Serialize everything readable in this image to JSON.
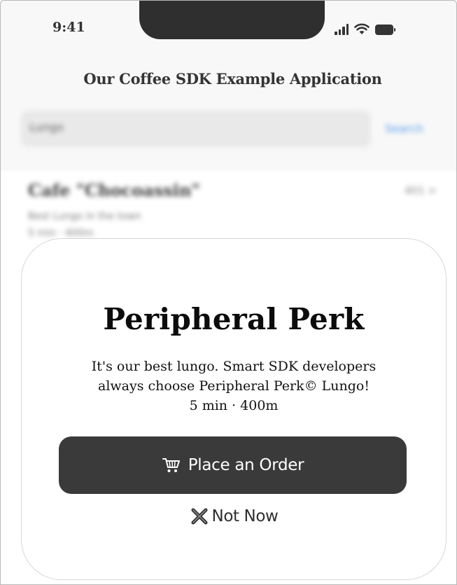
{
  "status_bar": {
    "time": "9:41",
    "icons": [
      "signal-icon",
      "wifi-icon",
      "battery-icon"
    ]
  },
  "header": {
    "title": "Our Coffee SDK Example Application"
  },
  "search": {
    "value": "Lungo",
    "button_label": "Search"
  },
  "list": {
    "items": [
      {
        "title": "Cafe \"Chocoassin\"",
        "meta": "401 >",
        "subtitle": "Best Lungo in the town",
        "detail": "5 min · 400m"
      }
    ]
  },
  "sheet": {
    "title": "Peripheral Perk",
    "description_line1": "It's our best lungo. Smart SDK developers",
    "description_line2": "always choose Peripheral Perk© Lungo!",
    "description_line3": "5 min · 400m",
    "primary_button": {
      "label": "Place an Order",
      "icon": "cart-icon"
    },
    "secondary_button": {
      "label": "Not Now",
      "icon": "close-x-icon"
    }
  },
  "colors": {
    "background": "#f7f7f7",
    "primary_button": "#3a3a3a",
    "search_accent": "#3a8be8",
    "sheet_border": "#d7d7d7"
  }
}
